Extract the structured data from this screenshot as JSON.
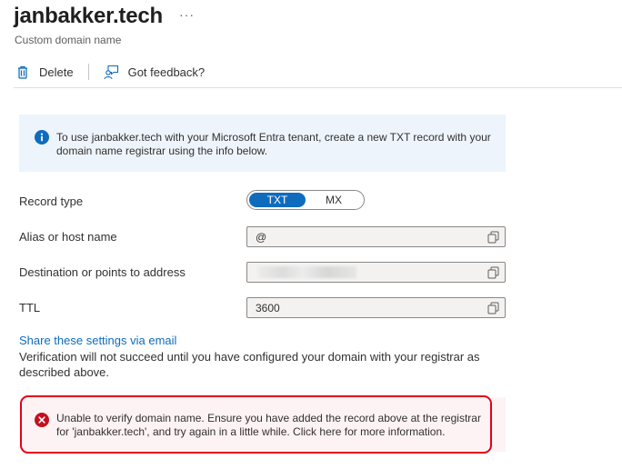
{
  "header": {
    "title": "janbakker.tech",
    "more": "···",
    "subtitle": "Custom domain name"
  },
  "toolbar": {
    "delete_label": "Delete",
    "feedback_label": "Got feedback?"
  },
  "info_banner": {
    "text": "To use janbakker.tech with your Microsoft Entra tenant, create a new TXT record with your domain name registrar using the info below."
  },
  "form": {
    "record_type_label": "Record type",
    "record_type_options": [
      "TXT",
      "MX"
    ],
    "record_type_selected": "TXT",
    "alias_label": "Alias or host name",
    "alias_value": "@",
    "destination_label": "Destination or points to address",
    "ttl_label": "TTL",
    "ttl_value": "3600"
  },
  "share_link": "Share these settings via email",
  "verification_note": "Verification will not succeed until you have configured your domain with your registrar as described above.",
  "error_banner": {
    "text": "Unable to verify domain name. Ensure you have added the record above at the registrar for 'janbakker.tech', and try again in a little while. Click here for more information."
  },
  "icons": {
    "delete": "trash-icon",
    "feedback": "feedback-person-icon",
    "info": "info-icon",
    "copy": "copy-icon",
    "error": "error-icon"
  },
  "colors": {
    "accent": "#0f6cbd",
    "info_bg": "#eef4fb",
    "error_border": "#e3001b",
    "error_icon": "#c50f1f",
    "error_bg": "#fdf3f4"
  }
}
